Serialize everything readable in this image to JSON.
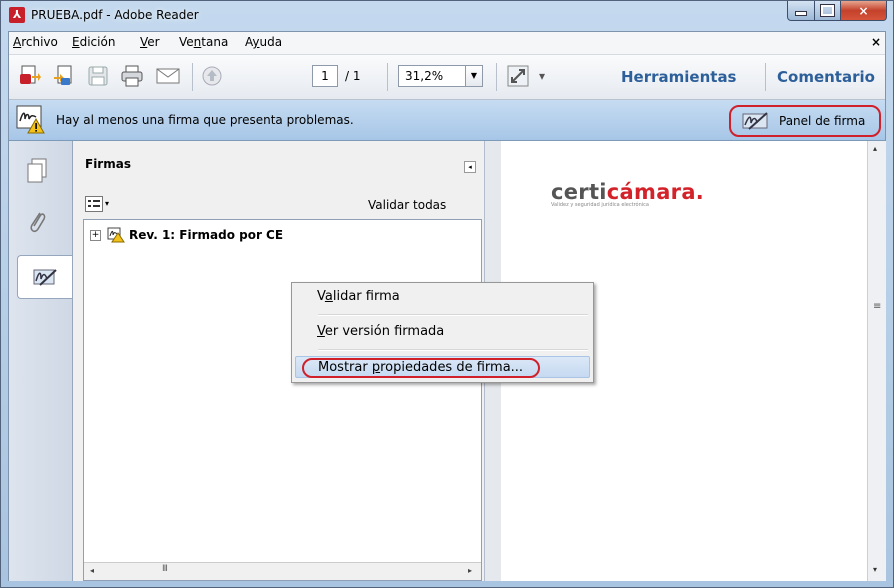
{
  "window": {
    "title": "PRUEBA.pdf - Adobe Reader",
    "app_icon_glyph": "⅄"
  },
  "menubar": {
    "items": [
      {
        "label": "Archivo",
        "ul": "A",
        "rest": "rchivo"
      },
      {
        "label": "Edición",
        "ul": "E",
        "rest": "dición"
      },
      {
        "label": "Ver",
        "ul": "V",
        "rest": "er"
      },
      {
        "label": "Ventana",
        "pre": "Ve",
        "ul": "n",
        "rest": "tana"
      },
      {
        "label": "Ayuda",
        "pre": "A",
        "ul": "y",
        "rest": "uda"
      }
    ],
    "close_glyph": "×"
  },
  "toolbar": {
    "page_current": "1",
    "page_total": "/ 1",
    "zoom": "31,2%",
    "zoom_arrow": "▼",
    "more_arrow": "▾",
    "herramientas": "Herramientas",
    "comentario": "Comentario"
  },
  "notification": {
    "message": "Hay al menos una firma que presenta problemas.",
    "panel_button": "Panel de firma"
  },
  "signatures_panel": {
    "title": "Firmas",
    "collapse_glyph": "◂",
    "validate_all": "Validar todas",
    "options_arrow": "▾",
    "entry": {
      "expander": "+",
      "label": "Rev. 1: Firmado por CE"
    },
    "scroll_left": "◂",
    "scroll_right": "▸",
    "scroll_grip": "III"
  },
  "document": {
    "logo_prefix": "certi",
    "logo_accent": "cámara.",
    "logo_tagline": "Validez y seguridad jurídica electrónica"
  },
  "context_menu": {
    "items": [
      {
        "pre": "V",
        "ul": "a",
        "rest": "lidar firma"
      },
      {
        "pre": "",
        "ul": "V",
        "rest": "er versión firmada"
      },
      {
        "pre": "Mostrar ",
        "ul": "p",
        "rest": "ropiedades de firma..."
      }
    ]
  },
  "vscroll": {
    "up": "▴",
    "down": "▾",
    "grip": "≡"
  },
  "colors": {
    "accent_blue": "#2d5f9a",
    "highlight_red": "#d0202a",
    "logo_red": "#d3222a"
  }
}
